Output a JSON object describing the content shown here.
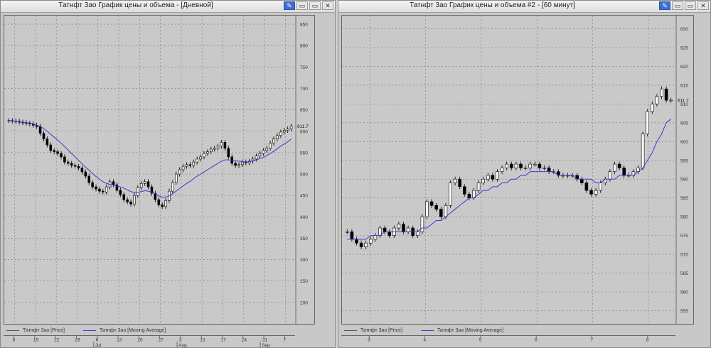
{
  "windows": [
    {
      "title": "Татнфт 3ао График цены и объема - [Дневной]",
      "legend": [
        "Татнфт 3ао [Price]",
        "Татнфт 3ао [Moving Average]"
      ],
      "last_value_label": "611.7"
    },
    {
      "title": "Татнфт 3ао График цены и объема #2 - [60 минут]",
      "legend": [
        "Татнфт 3ао [Price]",
        "Татнфт 3ао [Moving Average]"
      ],
      "last_value_label": "611.7"
    }
  ],
  "buttons": {
    "pen": "✎",
    "minimize": "▭",
    "restore": "▭",
    "close": "✕"
  },
  "colors": {
    "candle": "#000000",
    "ma": "#3a3ad0",
    "grid": "#7a7a7a"
  },
  "chart_data": [
    {
      "type": "candlestick",
      "title": "Татнфт 3ао График цены и объема - [Дневной]",
      "ylim": [
        150,
        870
      ],
      "yticks": [
        200,
        250,
        300,
        350,
        400,
        450,
        500,
        550,
        600,
        650,
        700,
        750,
        800,
        850
      ],
      "xticks": [
        "8",
        "15",
        "22",
        "29",
        "6",
        "13",
        "20",
        "27",
        "3",
        "10",
        "17",
        "24",
        "31",
        "7"
      ],
      "months": [
        "Jul",
        "Aug",
        "Sep"
      ],
      "grid": true,
      "series": [
        {
          "name": "Татнфт 3ао [Price]",
          "values": [
            625,
            624,
            623,
            621,
            620,
            619,
            617,
            614,
            611,
            595,
            582,
            568,
            555,
            552,
            548,
            540,
            528,
            525,
            520,
            518,
            514,
            505,
            495,
            480,
            470,
            465,
            460,
            458,
            470,
            482,
            475,
            462,
            452,
            440,
            435,
            430,
            450,
            468,
            478,
            482,
            470,
            455,
            440,
            428,
            424,
            438,
            460,
            480,
            500,
            510,
            518,
            522,
            520,
            528,
            535,
            540,
            548,
            552,
            558,
            560,
            565,
            574,
            560,
            540,
            525,
            520,
            522,
            528,
            526,
            530,
            535,
            542,
            548,
            555,
            560,
            572,
            582,
            590,
            598,
            602,
            605,
            612
          ]
        },
        {
          "name": "Татнфт 3ао [Moving Average]",
          "values": [
            625,
            624,
            623,
            622,
            621,
            620,
            619,
            617,
            614,
            611,
            606,
            600,
            593,
            586,
            579,
            572,
            564,
            556,
            548,
            540,
            532,
            524,
            516,
            509,
            501,
            494,
            488,
            482,
            478,
            476,
            474,
            472,
            470,
            467,
            463,
            459,
            457,
            457,
            459,
            461,
            460,
            458,
            454,
            449,
            446,
            446,
            449,
            454,
            460,
            466,
            472,
            478,
            483,
            489,
            495,
            500,
            505,
            510,
            515,
            520,
            525,
            530,
            533,
            533,
            532,
            531,
            530,
            529,
            528,
            529,
            531,
            533,
            536,
            539,
            543,
            548,
            553,
            559,
            565,
            570,
            575,
            582
          ]
        }
      ]
    },
    {
      "type": "candlestick",
      "title": "Татнфт 3ао График цены и объема #2 - [60 минут]",
      "ylim": [
        551.5,
        633.5
      ],
      "yticks": [
        555,
        560,
        565,
        570,
        575,
        580,
        585,
        590,
        595,
        600,
        605,
        610,
        615,
        620,
        625,
        630
      ],
      "xticks": [
        "3",
        "4",
        "5",
        "6",
        "7",
        "8"
      ],
      "grid": true,
      "series": [
        {
          "name": "Татнфт 3ао [Price]",
          "values": [
            576,
            574,
            573,
            572,
            573,
            574,
            575,
            577,
            576,
            575,
            577,
            578,
            576,
            577,
            575,
            576,
            580,
            584,
            583,
            582,
            580,
            583,
            589,
            590,
            588,
            586,
            585,
            587,
            589,
            590,
            591,
            590,
            592,
            593,
            594,
            593,
            594,
            593,
            593,
            594,
            594,
            593,
            593,
            592,
            592,
            591,
            591,
            591,
            591,
            590,
            589,
            587,
            586,
            587,
            589,
            590,
            592,
            594,
            593,
            591,
            591,
            592,
            593,
            602,
            608,
            610,
            612,
            614,
            611,
            611
          ]
        },
        {
          "name": "Татнфт 3ао [Moving Average]",
          "values": [
            574,
            574,
            574,
            574,
            574,
            575,
            575,
            575,
            576,
            576,
            576,
            576,
            576,
            576,
            576,
            576,
            577,
            577,
            578,
            579,
            579,
            580,
            581,
            582,
            583,
            584,
            585,
            585,
            586,
            587,
            587,
            588,
            588,
            589,
            589,
            590,
            590,
            591,
            591,
            592,
            592,
            592,
            592,
            592,
            592,
            591,
            591,
            591,
            591,
            590,
            590,
            590,
            590,
            589,
            589,
            590,
            590,
            590,
            591,
            591,
            591,
            591,
            592,
            593,
            595,
            597,
            600,
            602,
            605,
            606
          ]
        }
      ]
    }
  ]
}
